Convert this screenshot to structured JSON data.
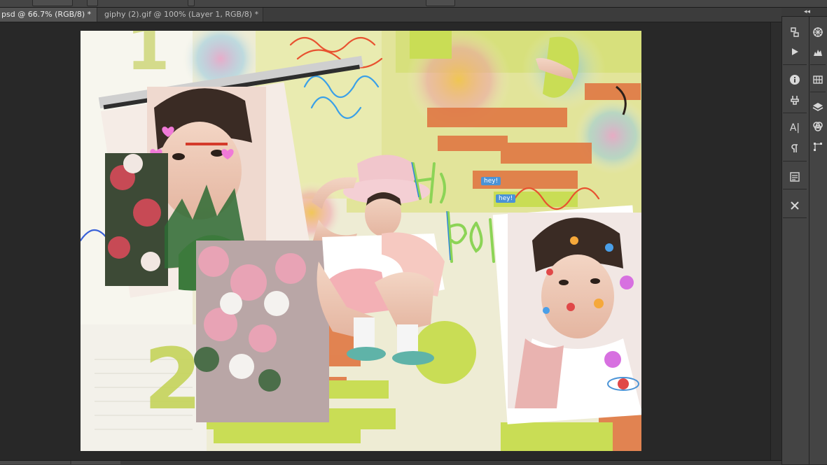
{
  "tabs": [
    {
      "label": "psd @ 66.7% (RGB/8) *",
      "close": "×",
      "active": true
    },
    {
      "label": "giphy (2).gif @ 100% (Layer 1, RGB/8) *",
      "close": "×",
      "active": false
    }
  ],
  "panel": {
    "collapse_glyph": "◂◂",
    "text_tool_label": "A|"
  },
  "canvas": {
    "stickers": [
      "hey!",
      "hey!"
    ],
    "numbers": [
      "1",
      "2"
    ]
  },
  "colors": {
    "chrome_dark": "#282828",
    "chrome_panel": "#444444",
    "tab_active": "#535353",
    "lime": "#c9dd55",
    "orange": "#e07a45",
    "sticker_blue": "#4a93d6"
  }
}
